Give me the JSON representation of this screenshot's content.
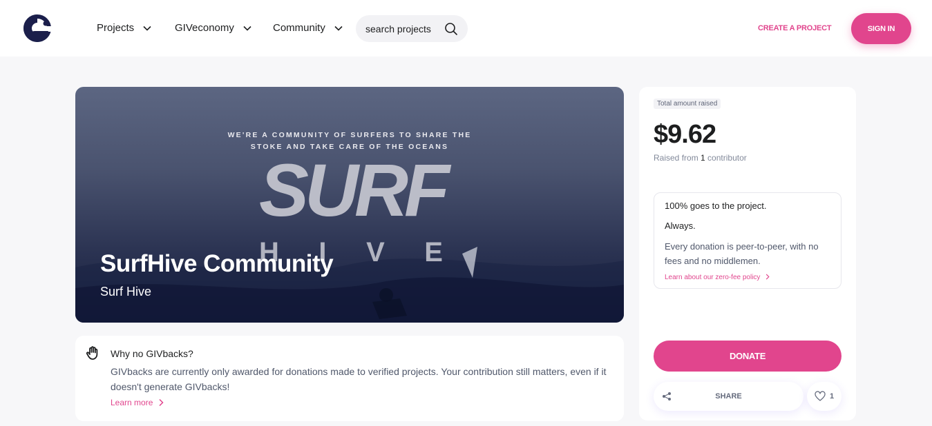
{
  "header": {
    "nav": [
      {
        "label": "Projects"
      },
      {
        "label": "GIVeconomy"
      },
      {
        "label": "Community"
      }
    ],
    "search_placeholder": "search projects",
    "create_label": "CREATE A PROJECT",
    "signin_label": "SIGN IN"
  },
  "hero": {
    "tagline_line1": "WE'RE A COMMUNITY OF SURFERS TO SHARE THE",
    "tagline_line2": "STOKE AND TAKE CARE OF THE OCEANS",
    "logo_word": "SURF",
    "logo_sub": [
      "H",
      "I",
      "V",
      "E"
    ],
    "title": "SurfHive Community",
    "subtitle": "Surf Hive"
  },
  "givbacks": {
    "title": "Why no GIVbacks?",
    "body": "GIVbacks are currently only awarded for donations made to verified projects. Your contribution still matters, even if it doesn't generate GIVbacks!",
    "learn_more": "Learn more"
  },
  "panel": {
    "badge": "Total amount raised",
    "amount": "$9.62",
    "raised_prefix": "Raised from ",
    "contributors": "1",
    "raised_suffix": " contributor",
    "info_line1": "100% goes to the project.",
    "info_line2": "Always.",
    "info_line3": "Every donation is peer-to-peer, with no fees and no middlemen.",
    "info_link": "Learn about our zero-fee policy",
    "donate_label": "DONATE",
    "share_label": "SHARE",
    "likes": "1"
  },
  "colors": {
    "accent": "#e1458d",
    "brand_dark": "#1b1f4b"
  }
}
